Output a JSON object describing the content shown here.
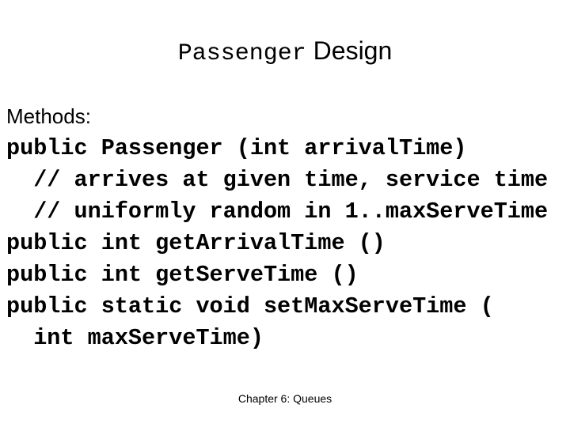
{
  "slide": {
    "title": {
      "code_part": "Passenger",
      "text_part": " Design"
    },
    "section_heading": "Methods:",
    "code_lines": [
      "public Passenger (int arrivalTime)",
      "  // arrives at given time, service time",
      "  // uniformly random in 1..maxServeTime",
      "public int getArrivalTime ()",
      "public int getServeTime ()",
      "public static void setMaxServeTime (",
      "  int maxServeTime)"
    ],
    "footer": "Chapter 6: Queues"
  }
}
